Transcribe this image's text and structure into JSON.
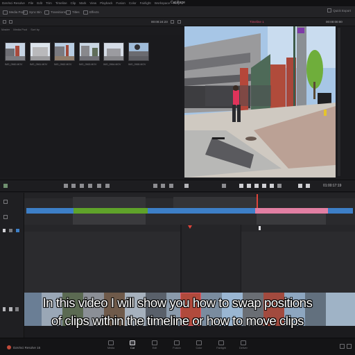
{
  "app": {
    "name": "DaVinci Resolve",
    "menu": [
      "File",
      "Edit",
      "Trim",
      "Timeline",
      "Clip",
      "Mark",
      "View",
      "Playback",
      "Fusion",
      "Color",
      "Fairlight",
      "Workspace",
      "Help"
    ],
    "page_title": "Cut Page"
  },
  "toolbar": {
    "media_pool": "Media Pool",
    "sync_bin": "Sync Bin",
    "transitions": "Transitions",
    "titles": "Titles",
    "effects": "Effects",
    "quick_export": "Quick Export"
  },
  "viewer_bar": {
    "source_timecode": "00:00:24:23",
    "timeline_name": "Timeline 1",
    "record_timecode": "00:00:00:00"
  },
  "breadcrumbs": [
    "Master",
    "Media Pool",
    "Sort by"
  ],
  "clips": [
    {
      "name": "IMG_0560.MOV",
      "sky": "#c7d4e4",
      "ground": "#7b7b80"
    },
    {
      "name": "IMG_0561.MOV",
      "sky": "#dde4ec",
      "ground": "#9a9a9c"
    },
    {
      "name": "IMG_0562.MOV",
      "sky": "#b9cde2",
      "ground": "#8f7d6c"
    },
    {
      "name": "IMG_0563.MOV",
      "sky": "#cad6e3",
      "ground": "#6f6f75"
    },
    {
      "name": "IMG_0564.MOV",
      "sky": "#d5dce6",
      "ground": "#848488"
    },
    {
      "name": "IMG_0565.MOV",
      "sky": "#9fbbd8",
      "ground": "#5d5d62"
    }
  ],
  "transport": {
    "timecode": "01:00:17:19"
  },
  "timeline_clips": [
    {
      "color": "#3d7fc7"
    },
    {
      "color": "#5fa32a"
    },
    {
      "color": "#3d7fc7"
    },
    {
      "color": "#e27fa3"
    },
    {
      "color": "#3d7fc7"
    }
  ],
  "subtitles": {
    "line1": "In this video I will show you how to swap positions",
    "line2": "of clips within the timeline or how to move clips"
  },
  "pages": [
    "Media",
    "Cut",
    "Edit",
    "Fusion",
    "Color",
    "Fairlight",
    "Deliver"
  ],
  "active_page": "Cut",
  "brand": "DaVinci Resolve 16"
}
